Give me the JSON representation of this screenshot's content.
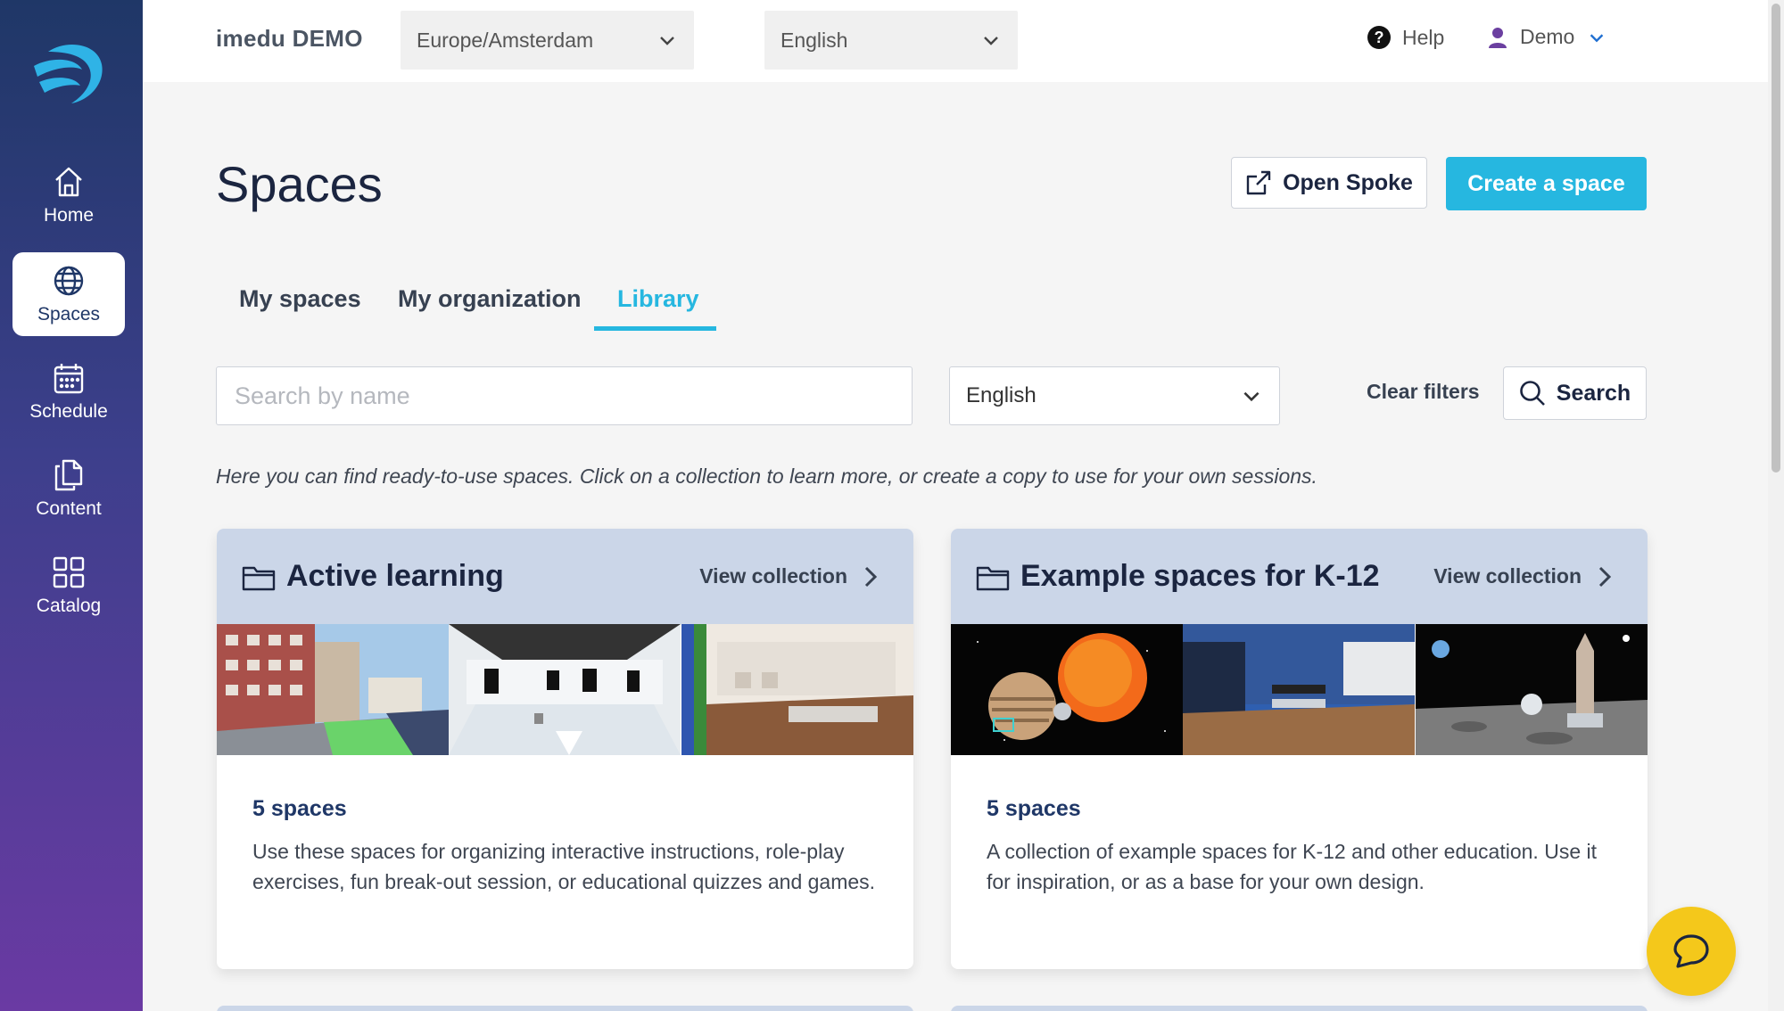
{
  "sidebar": {
    "items": [
      {
        "label": "Home",
        "icon": "home-icon"
      },
      {
        "label": "Spaces",
        "icon": "globe-icon",
        "active": true
      },
      {
        "label": "Schedule",
        "icon": "calendar-icon"
      },
      {
        "label": "Content",
        "icon": "documents-icon"
      },
      {
        "label": "Catalog",
        "icon": "grid-icon"
      }
    ]
  },
  "topbar": {
    "brand": "imedu DEMO",
    "timezone": "Europe/Amsterdam",
    "language": "English",
    "help": "Help",
    "user": "Demo"
  },
  "page": {
    "title": "Spaces",
    "open_spoke": "Open Spoke",
    "create_space": "Create a space"
  },
  "tabs": [
    {
      "label": "My spaces"
    },
    {
      "label": "My organization"
    },
    {
      "label": "Library",
      "active": true
    }
  ],
  "filters": {
    "search_placeholder": "Search by name",
    "language": "English",
    "clear": "Clear filters",
    "search": "Search"
  },
  "intro": "Here you can find ready-to-use spaces. Click on a collection to learn more, or create a copy to use for your own sessions.",
  "collections": [
    {
      "title": "Active learning",
      "view": "View collection",
      "count": "5 spaces",
      "description": "Use these spaces for organizing interactive instructions, role-play exercises, fun break-out session, or educational quizzes and games."
    },
    {
      "title": "Example spaces for K-12",
      "view": "View collection",
      "count": "5 spaces",
      "description": "A collection of example spaces for K-12 and other education. Use it for inspiration, or as a base for your own design."
    }
  ],
  "colors": {
    "accent": "#26b7e0",
    "sidebar_top": "#1f3767",
    "sidebar_bottom": "#6a3aa3",
    "card_header": "#cbd6e8",
    "chat_button": "#f4c81b"
  }
}
